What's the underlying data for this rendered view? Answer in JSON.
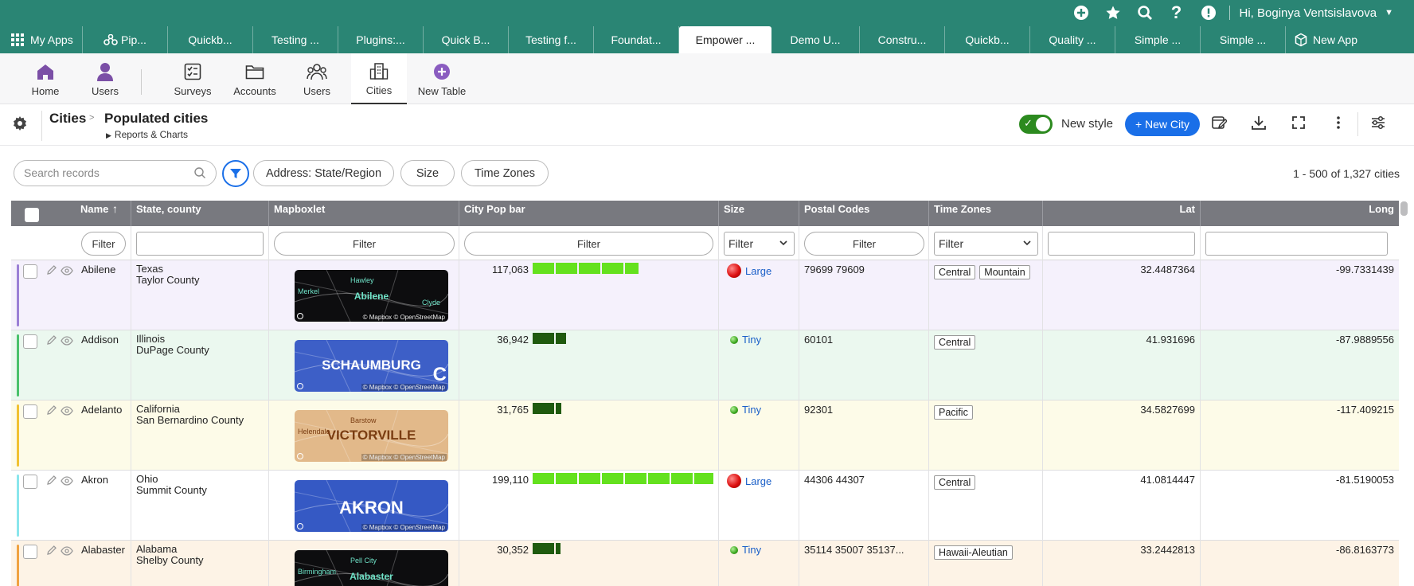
{
  "topbar": {
    "user_greeting": "Hi, Boginya Ventsislavova",
    "icons": [
      "plus-circle-icon",
      "star-icon",
      "search-icon",
      "help-icon",
      "alert-icon",
      "caret-down-icon"
    ]
  },
  "apps": {
    "my_apps": "My Apps",
    "tabs": [
      "Pip...",
      "Quickb...",
      "Testing ...",
      "Plugins:...",
      "Quick B...",
      "Testing f...",
      "Foundat...",
      "Empower ...",
      "Demo U...",
      "Constru...",
      "Quickb...",
      "Quality ...",
      "Simple ...",
      "Simple ..."
    ],
    "active_index": 7,
    "new_app": "New App"
  },
  "tablenav": {
    "items": [
      {
        "label": "Home",
        "icon": "home-icon"
      },
      {
        "label": "Users",
        "icon": "user-icon"
      },
      {
        "label": "Surveys",
        "icon": "checklist-icon"
      },
      {
        "label": "Accounts",
        "icon": "folder-icon"
      },
      {
        "label": "Users",
        "icon": "users-group-icon"
      },
      {
        "label": "Cities",
        "icon": "buildings-icon"
      },
      {
        "label": "New Table",
        "icon": "plus-circle-icon"
      }
    ],
    "active_label": "Cities"
  },
  "header": {
    "table": "Cities",
    "report": "Populated cities",
    "sub": "Reports & Charts",
    "new_style": "New style",
    "new_style_on": true,
    "new_record": "+ New City"
  },
  "filters": {
    "search_placeholder": "Search records",
    "pills": [
      "Address: State/Region",
      "Size",
      "Time Zones"
    ],
    "record_count": "1 - 500 of 1,327 cities"
  },
  "columns": {
    "name": "Name",
    "state": "State, county",
    "map": "Mapboxlet",
    "pop": "City Pop bar",
    "size": "Size",
    "postal": "Postal Codes",
    "tz": "Time Zones",
    "lat": "Lat",
    "long": "Long",
    "sort_indicator": "↑"
  },
  "filter_row": {
    "pill_label": "Filter",
    "select_label": "Filter"
  },
  "rows": [
    {
      "name": "Abilene",
      "state": "Texas",
      "county": "Taylor County",
      "pop": "117,063",
      "pop_value": 117063,
      "size": "Large",
      "postal": "79699 79609",
      "tz": [
        "Central",
        "Mountain"
      ],
      "lat": "32.4487364",
      "long": "-99.7331439",
      "bg": "#f5f1fc",
      "accent": "#9b7fd6",
      "map_label": "Abilene",
      "map_bg": "#0d0d0f",
      "map_fg": "#6fe3c8",
      "map_extra": [
        "Merkel",
        "Hawley",
        "Clyde"
      ]
    },
    {
      "name": "Addison",
      "state": "Illinois",
      "county": "DuPage County",
      "pop": "36,942",
      "pop_value": 36942,
      "size": "Tiny",
      "postal": "60101",
      "tz": [
        "Central"
      ],
      "lat": "41.931696",
      "long": "-87.9889556",
      "bg": "#ebf8ef",
      "accent": "#4ac26b",
      "map_label": "SCHAUMBURG",
      "map_bg": "#3d5fc7",
      "map_fg": "#ffffff",
      "map_extra": [
        "C"
      ]
    },
    {
      "name": "Adelanto",
      "state": "California",
      "county": "San Bernardino County",
      "pop": "31,765",
      "pop_value": 31765,
      "size": "Tiny",
      "postal": "92301",
      "tz": [
        "Pacific"
      ],
      "lat": "34.5827699",
      "long": "-117.409215",
      "bg": "#fdfbe8",
      "accent": "#f1c232",
      "map_label": "VICTORVILLE",
      "map_bg": "#e2b98a",
      "map_fg": "#7a3d12",
      "map_extra": [
        "Helendale",
        "Barstow"
      ]
    },
    {
      "name": "Akron",
      "state": "Ohio",
      "county": "Summit County",
      "pop": "199,110",
      "pop_value": 199110,
      "size": "Large",
      "postal": "44306 44307",
      "tz": [
        "Central"
      ],
      "lat": "41.0814447",
      "long": "-81.5190053",
      "bg": "#ffffff",
      "accent": "#8ae6ec",
      "map_label": "AKRON",
      "map_bg": "#3559c4",
      "map_fg": "#ffffff",
      "map_extra": []
    },
    {
      "name": "Alabaster",
      "state": "Alabama",
      "county": "Shelby County",
      "pop": "30,352",
      "pop_value": 30352,
      "size": "Tiny",
      "postal": "35114 35007 35137...",
      "tz": [
        "Hawaii-Aleutian"
      ],
      "lat": "33.2442813",
      "long": "-86.8163773",
      "bg": "#fdf3e6",
      "accent": "#f0a241",
      "map_label": "Alabaster",
      "map_bg": "#0d0d0f",
      "map_fg": "#6fe3c8",
      "map_extra": [
        "Birmingham",
        "Pell City"
      ]
    }
  ],
  "map_attribution": "© Mapbox © OpenStreetMap",
  "colors": {
    "brand": "#2a8574",
    "primary": "#1a6fe8",
    "pop_bar_large": "#64e11e",
    "pop_bar_small": "#1f5a0e"
  }
}
